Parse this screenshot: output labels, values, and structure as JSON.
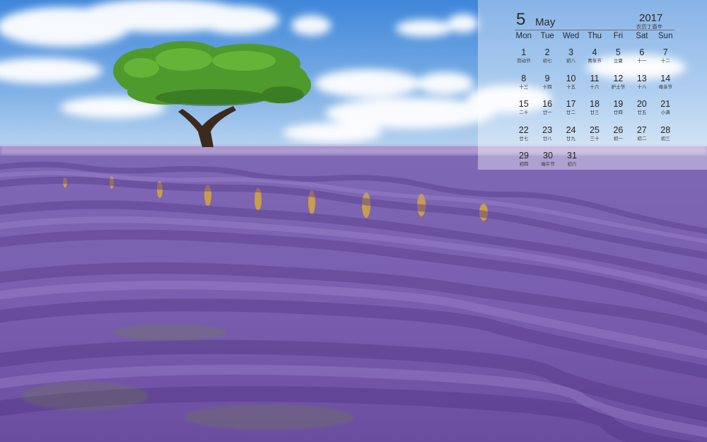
{
  "calendar": {
    "month_number": "5",
    "month_name": "May",
    "year": "2017",
    "year_subtitle": "农历丁酉年",
    "weekdays": [
      "Mon",
      "Tue",
      "Wed",
      "Thu",
      "Fri",
      "Sat",
      "Sun"
    ],
    "weeks": [
      [
        {
          "day": "1",
          "lunar": "劳动节"
        },
        {
          "day": "2",
          "lunar": "初七"
        },
        {
          "day": "3",
          "lunar": "初八"
        },
        {
          "day": "4",
          "lunar": "青年节"
        },
        {
          "day": "5",
          "lunar": "立夏"
        },
        {
          "day": "6",
          "lunar": "十一"
        },
        {
          "day": "7",
          "lunar": "十二"
        }
      ],
      [
        {
          "day": "8",
          "lunar": "十三"
        },
        {
          "day": "9",
          "lunar": "十四"
        },
        {
          "day": "10",
          "lunar": "十五"
        },
        {
          "day": "11",
          "lunar": "十六"
        },
        {
          "day": "12",
          "lunar": "护士节"
        },
        {
          "day": "13",
          "lunar": "十八"
        },
        {
          "day": "14",
          "lunar": "母亲节"
        }
      ],
      [
        {
          "day": "15",
          "lunar": "二十"
        },
        {
          "day": "16",
          "lunar": "廿一"
        },
        {
          "day": "17",
          "lunar": "廿二"
        },
        {
          "day": "18",
          "lunar": "廿三"
        },
        {
          "day": "19",
          "lunar": "廿四"
        },
        {
          "day": "20",
          "lunar": "廿五"
        },
        {
          "day": "21",
          "lunar": "小满"
        }
      ],
      [
        {
          "day": "22",
          "lunar": "廿七"
        },
        {
          "day": "23",
          "lunar": "廿八"
        },
        {
          "day": "24",
          "lunar": "廿九"
        },
        {
          "day": "25",
          "lunar": "三十"
        },
        {
          "day": "26",
          "lunar": "初一"
        },
        {
          "day": "27",
          "lunar": "初二"
        },
        {
          "day": "28",
          "lunar": "初三"
        }
      ],
      [
        {
          "day": "29",
          "lunar": "初四"
        },
        {
          "day": "30",
          "lunar": "端午节"
        },
        {
          "day": "31",
          "lunar": "初六"
        }
      ]
    ]
  }
}
